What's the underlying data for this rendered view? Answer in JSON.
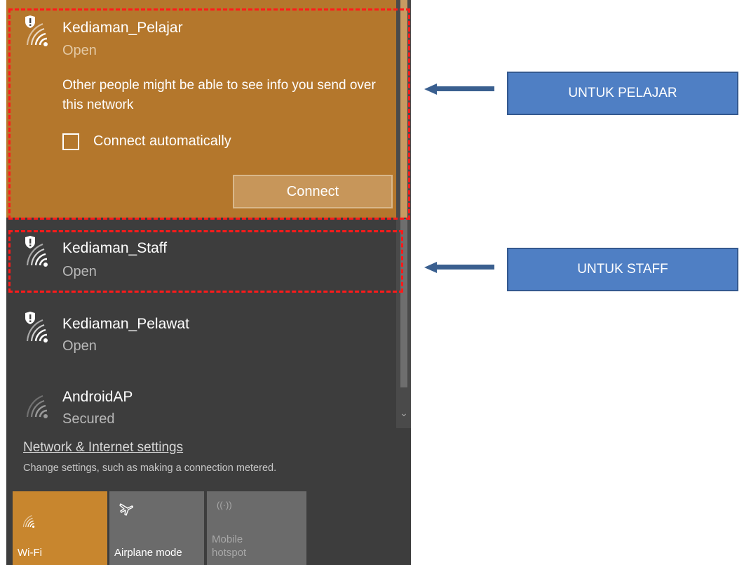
{
  "networks": [
    {
      "name": "Kediaman_Pelajar",
      "status": "Open",
      "expanded": true,
      "warning": "Other people might be able to see info you send over this network",
      "connect_auto_label": "Connect automatically",
      "connect_auto_checked": false,
      "connect_label": "Connect",
      "icon": "wifi-shield-icon"
    },
    {
      "name": "Kediaman_Staff",
      "status": "Open",
      "icon": "wifi-shield-icon"
    },
    {
      "name": "Kediaman_Pelawat",
      "status": "Open",
      "icon": "wifi-shield-icon"
    },
    {
      "name": "AndroidAP",
      "status": "Secured",
      "icon": "wifi-icon"
    }
  ],
  "settings": {
    "link": "Network & Internet settings",
    "description": "Change settings, such as making a connection metered."
  },
  "quick_actions": [
    {
      "label": "Wi-Fi",
      "icon": "wifi-icon",
      "state": "on"
    },
    {
      "label": "Airplane mode",
      "icon": "airplane-icon",
      "state": "off"
    },
    {
      "label": "Mobile hotspot",
      "label_line1": "Mobile",
      "label_line2": "hotspot",
      "icon": "hotspot-icon",
      "state": "disabled"
    }
  ],
  "annotations": {
    "pelajar_label": "UNTUK PELAJAR",
    "staff_label": "UNTUK STAFF"
  },
  "colors": {
    "accent": "#b4772c",
    "panel": "#3d3d3d",
    "highlight": "#ff1a1a",
    "label_box": "#4f7fc4",
    "arrow": "#3a5f8f"
  }
}
